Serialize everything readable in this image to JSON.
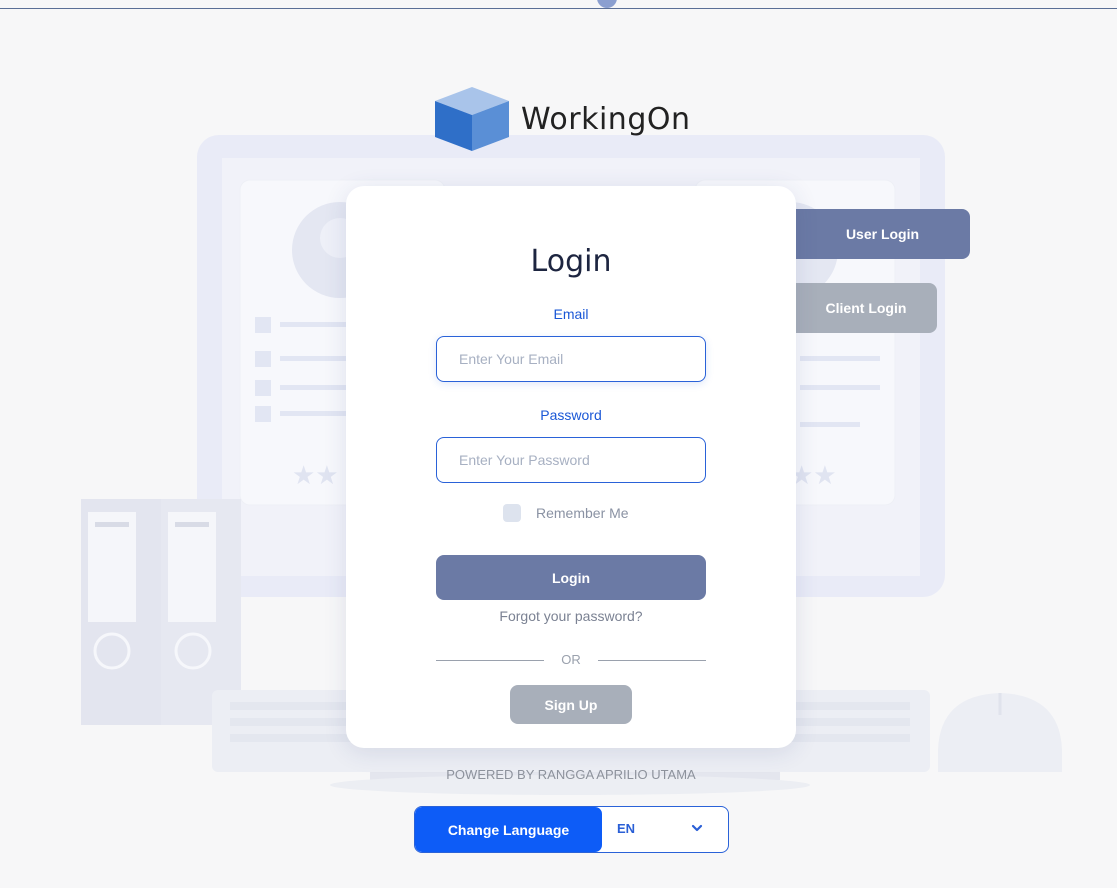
{
  "brand": {
    "name": "WorkingOn"
  },
  "tabs": {
    "user_login": "User Login",
    "client_login": "Client Login"
  },
  "login": {
    "title": "Login",
    "email_label": "Email",
    "email_placeholder": "Enter Your Email",
    "password_label": "Password",
    "password_placeholder": "Enter Your Password",
    "remember_label": "Remember Me",
    "login_button": "Login",
    "forgot_link": "Forgot your password?",
    "or_text": "OR",
    "signup_button": "Sign Up"
  },
  "footer": {
    "powered_by": "POWERED BY RANGGA APRILIO UTAMA"
  },
  "language": {
    "button_label": "Change Language",
    "selected": "EN"
  },
  "colors": {
    "accent": "#6b7aa5",
    "primary_blue": "#0d5cf7",
    "muted": "#a8afba"
  }
}
